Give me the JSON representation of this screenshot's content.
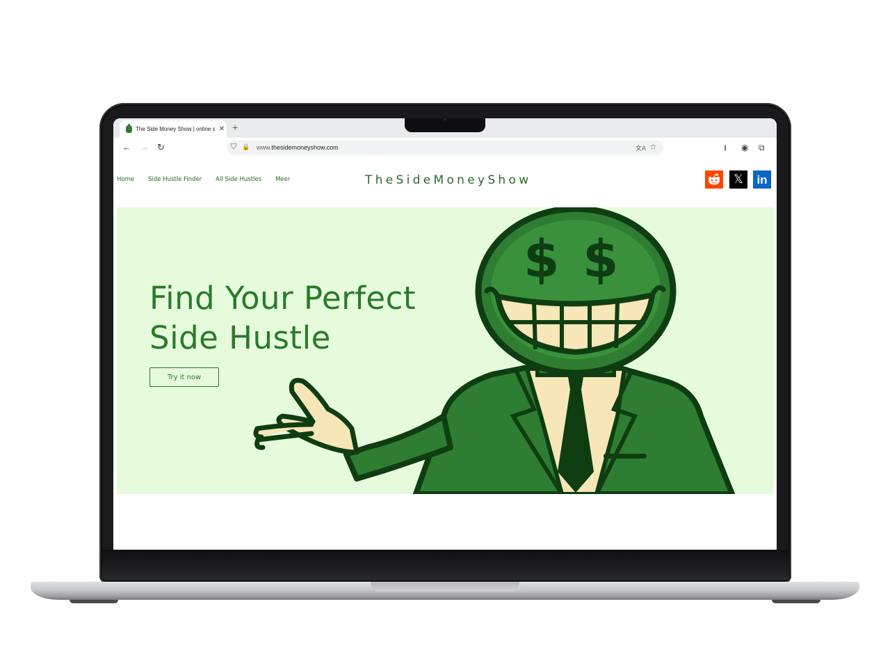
{
  "browser": {
    "tab_title": "The Side Money Show | online s",
    "tab_close": "✕",
    "new_tab": "+",
    "url_prefix": "www.",
    "url_domain": "thesidemoneyshow.com",
    "back_icon": "←",
    "forward_icon": "→",
    "reload_icon": "↻",
    "shield_icon": "⛉",
    "lock_icon": "🔒",
    "translate_icon": "文A",
    "bookmark_icon": "☆",
    "download_icon": "⭳",
    "account_icon": "◉",
    "extensions_icon": "⧉"
  },
  "site": {
    "nav": {
      "items": [
        "Home",
        "Side Hustle Finder",
        "All Side Hustles",
        "Meer"
      ]
    },
    "logo": "TheSideMoneyShow",
    "social": {
      "x_label": "𝕏",
      "linkedin_label": "in"
    },
    "hero": {
      "headline_line1": "Find Your Perfect",
      "headline_line2": "Side Hustle",
      "cta_label": "Try it now"
    }
  },
  "colors": {
    "brand_green": "#2a7a2a",
    "hero_bg": "#e6fadc",
    "reddit": "#ff4500",
    "x": "#000000",
    "linkedin": "#0a66c2"
  }
}
